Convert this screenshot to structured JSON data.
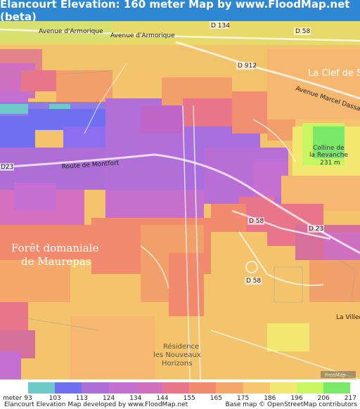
{
  "header": {
    "title": "Elancourt Elevation: 160 meter Map by www.FloodMap.net (beta)"
  },
  "map": {
    "labels": {
      "avenue_armorique_1": "Avenue d'Armorique",
      "avenue_armorique_2": "Avenue d'Armorique",
      "d134": "D 134",
      "d58_top": "D 58",
      "d912": "D 912",
      "la_clef": "La Clef de S",
      "avenue_marcel_dassault": "Avenue Marcel Dassault",
      "colline": "Colline de",
      "la_revanche": "la Revanche",
      "altitude": "231 m",
      "route_montfort": "Route de Montfort",
      "d23_left": "D23",
      "d58_mid": "D 58",
      "d23_right": "D 23",
      "foret_1": "Forêt domaniale",
      "foret_2": "de Maurepas",
      "d58_low": "D 58",
      "la_villed": "La Villed",
      "residence_1": "Résidence",
      "residence_2": "les Nouveaux",
      "residence_3": "Horizons",
      "watermark": "FreeMap"
    }
  },
  "legend": {
    "unit": "meter",
    "values": [
      "93",
      "103",
      "113",
      "124",
      "134",
      "144",
      "155",
      "165",
      "175",
      "186",
      "196",
      "206",
      "217"
    ],
    "colors": [
      "#6ec9c9",
      "#6f6ff0",
      "#ad6fd6",
      "#c66fd2",
      "#cf6fbf",
      "#e87589",
      "#f28a6d",
      "#f6a86a",
      "#f7c76d",
      "#f2e870",
      "#c8f562",
      "#7ae868"
    ]
  },
  "footer": {
    "left": "Elancourt Elevation Map developed by www.FloodMap.net",
    "right": "Base map © OpenStreetMap contributors"
  }
}
